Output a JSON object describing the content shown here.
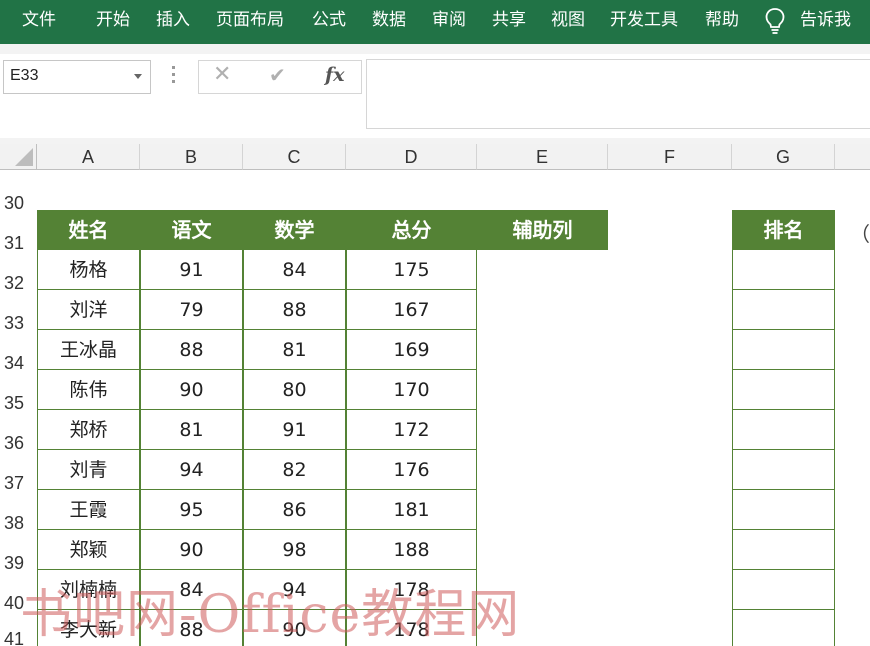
{
  "ribbon": {
    "tabs": [
      "文件",
      "开始",
      "插入",
      "页面布局",
      "公式",
      "数据",
      "审阅",
      "共享",
      "视图",
      "开发工具",
      "帮助"
    ],
    "tell_me": "告诉我",
    "tell_me_icon": "lightbulb-icon",
    "color": "#217346"
  },
  "formula_bar": {
    "name_box": "E33",
    "cancel_icon": "✕",
    "enter_icon": "✔",
    "fx_label": "fx",
    "formula": ""
  },
  "grid": {
    "columns": [
      "A",
      "B",
      "C",
      "D",
      "E",
      "F",
      "G"
    ],
    "rows": [
      "30",
      "31",
      "32",
      "33",
      "34",
      "35",
      "36",
      "37",
      "38",
      "39",
      "40",
      "41"
    ]
  },
  "table": {
    "headers": [
      "姓名",
      "语文",
      "数学",
      "总分",
      "辅助列"
    ],
    "rank_header": "排名",
    "header_color": "#548235",
    "rows": [
      {
        "name": "杨格",
        "chinese": "91",
        "math": "84",
        "total": "175"
      },
      {
        "name": "刘洋",
        "chinese": "79",
        "math": "88",
        "total": "167"
      },
      {
        "name": "王冰晶",
        "chinese": "88",
        "math": "81",
        "total": "169"
      },
      {
        "name": "陈伟",
        "chinese": "90",
        "math": "80",
        "total": "170"
      },
      {
        "name": "郑桥",
        "chinese": "81",
        "math": "91",
        "total": "172"
      },
      {
        "name": "刘青",
        "chinese": "94",
        "math": "82",
        "total": "176"
      },
      {
        "name": "王霞",
        "chinese": "95",
        "math": "86",
        "total": "181"
      },
      {
        "name": "郑颖",
        "chinese": "90",
        "math": "98",
        "total": "188"
      },
      {
        "name": "刘楠楠",
        "chinese": "84",
        "math": "94",
        "total": "178"
      },
      {
        "name": "李大新",
        "chinese": "88",
        "math": "90",
        "total": "178"
      }
    ],
    "overflow_text": "（#"
  },
  "watermark": "书吧网-Office教程网"
}
